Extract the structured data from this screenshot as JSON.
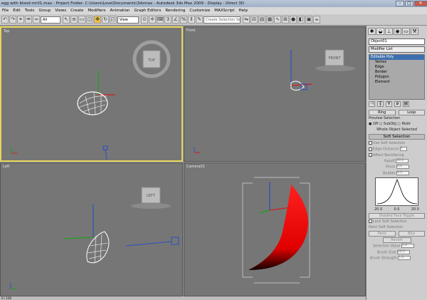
{
  "title": "egg with blood-mr01.max - Project Folder: C:\\Users\\Love\\Documents\\3dsmax - Autodesk 3ds Max 2009 - Display : Direct 3D",
  "menu": [
    "File",
    "Edit",
    "Tools",
    "Group",
    "Views",
    "Create",
    "Modifiers",
    "Animation",
    "Graph Editors",
    "Rendering",
    "Customize",
    "MAXScript",
    "Help"
  ],
  "toolbar": {
    "filter_value": "All",
    "refcoord_value": "View",
    "selection_set_placeholder": "Create Selection Set"
  },
  "viewports": {
    "top": {
      "label": "Top",
      "cube": "TOP"
    },
    "front": {
      "label": "Front",
      "cube": "FRONT"
    },
    "left": {
      "label": "Left",
      "cube": "LEFT"
    },
    "camera": {
      "label": "Camera01"
    }
  },
  "panel": {
    "object_name": "Object01",
    "modifier_list": "Modifier List",
    "stack": [
      "Editable Poly",
      "Vertex",
      "Edge",
      "Border",
      "Polygon",
      "Element"
    ],
    "ring_label": "Ring",
    "loop_label": "Loop",
    "preview_selection": "Preview Selection",
    "preview_off": "Off",
    "preview_subobj": "SubObj",
    "preview_multi": "Multi",
    "whole_object": "Whole Object Selected",
    "soft_selection": "Soft Selection",
    "use_soft_selection": "Use Soft Selection",
    "edge_distance": "Edge Distance",
    "edge_distance_value": "1",
    "affect_backfacing": "Affect Backfacing",
    "falloff_label": "Falloff",
    "falloff_value": "20.0",
    "pinch_label": "Pinch",
    "pinch_value": "0.0",
    "bubble_label": "Bubble",
    "bubble_value": "0.0",
    "curve_left": "20.0",
    "curve_mid": "0.0",
    "curve_right": "20.0",
    "shaded_face_toggle": "Shaded Face Toggle",
    "lock_soft_selection": "Lock Soft Selection",
    "paint_soft_selection": "Paint Soft Selection",
    "paint_label": "Paint",
    "blur_label": "Blur",
    "revert_label": "Revert",
    "selection_value": "Selection Value",
    "selection_value_num": "1.0",
    "brush_size": "Brush Size",
    "brush_size_num": "20.0",
    "brush_strength": "Brush Strength",
    "brush_strength_num": "1.0"
  },
  "status": {
    "frame": "0 / 100"
  }
}
